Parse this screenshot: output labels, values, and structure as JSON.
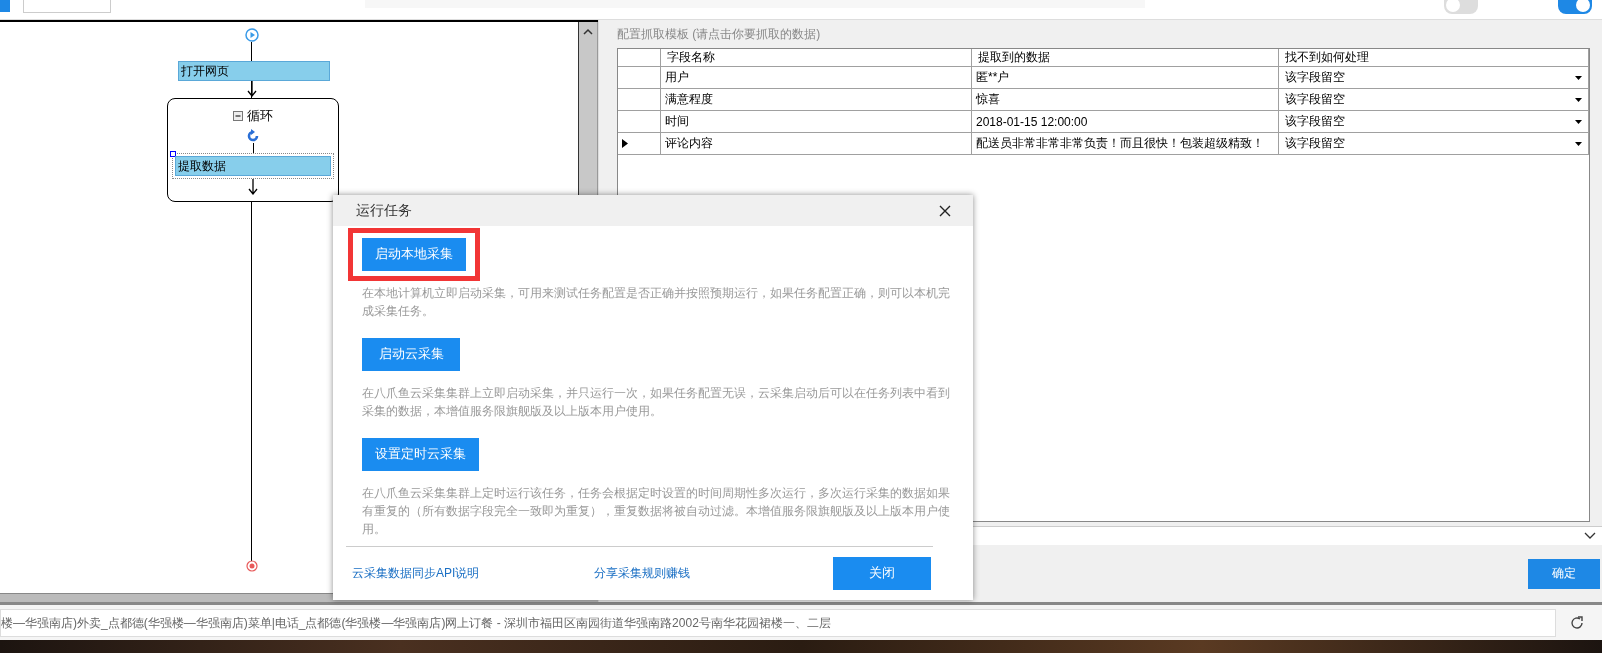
{
  "toolbar": {
    "toggles": [
      {
        "on": false
      },
      {
        "on": true
      }
    ]
  },
  "flow": {
    "nodes": [
      {
        "kind": "start"
      },
      {
        "kind": "action",
        "label": "打开网页"
      },
      {
        "kind": "loop",
        "label": "循环",
        "expanded": true,
        "children": [
          {
            "label": "提取数据",
            "selected": true
          }
        ]
      },
      {
        "kind": "end"
      }
    ]
  },
  "template": {
    "caption": "配置抓取模板 (请点击你要抓取的数据)",
    "columns": [
      "字段名称",
      "提取到的数据",
      "找不到如何处理"
    ],
    "rows": [
      {
        "field": "用户",
        "value": "匿**户",
        "action": "该字段留空",
        "selected": false
      },
      {
        "field": "满意程度",
        "value": "惊喜",
        "action": "该字段留空",
        "selected": false
      },
      {
        "field": "时间",
        "value": "2018-01-15 12:00:00",
        "action": "该字段留空",
        "selected": false
      },
      {
        "field": "评论内容",
        "value": "配送员非常非常非常负责！而且很快！包装超级精致！",
        "action": "该字段留空",
        "selected": true
      }
    ]
  },
  "confirm_button": "确定",
  "address": "楼—华强南店)外卖_点都德(华强楼—华强南店)菜单|电话_点都德(华强楼—华强南店)网上订餐 - 深圳市福田区南园街道华强南路2002号南华花园裙楼一、二层",
  "dialog": {
    "title": "运行任务",
    "options": [
      {
        "button": "启动本地采集",
        "description": "在本地计算机立即启动采集，可用来测试任务配置是否正确并按照预期运行，如果任务配置正确，则可以本机完成采集任务。",
        "highlighted": true
      },
      {
        "button": "启动云采集",
        "description": "在八爪鱼云采集集群上立即启动采集，并只运行一次，如果任务配置无误，云采集启动后可以在任务列表中看到采集的数据，本增值服务限旗舰版及以上版本用户使用。",
        "highlighted": false
      },
      {
        "button": "设置定时云采集",
        "description": "在八爪鱼云采集集群上定时运行该任务，任务会根据定时设置的时间周期性多次运行，多次运行采集的数据如果有重复的（所有数据字段完全一致即为重复），重复数据将被自动过滤。本增值服务限旗舰版及以上版本用户使用。",
        "highlighted": false
      }
    ],
    "links": [
      "云采集数据同步API说明",
      "分享采集规则赚钱"
    ],
    "close_button": "关闭"
  }
}
